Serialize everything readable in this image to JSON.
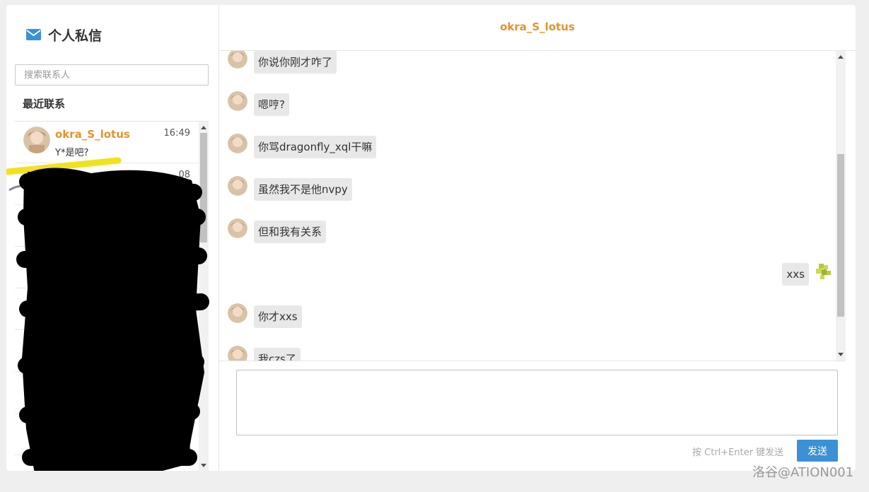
{
  "sidebar": {
    "title": "个人私信",
    "search_placeholder": "搜索联系人",
    "recent_label": "最近联系",
    "contacts": [
      {
        "name": "okra_S_lotus",
        "time": "16:49",
        "preview": "Y*是吧?"
      },
      {
        "name": "",
        "time": "08",
        "preview": ""
      }
    ]
  },
  "chat": {
    "title": "okra_S_lotus",
    "messages": [
      {
        "side": "left",
        "text": "你说你刚才咋了"
      },
      {
        "side": "left",
        "text": "嗯哼?"
      },
      {
        "side": "left",
        "text": "你骂dragonfly_xql干嘛"
      },
      {
        "side": "left",
        "text": "虽然我不是他nvpy"
      },
      {
        "side": "left",
        "text": "但和我有关系"
      },
      {
        "side": "right",
        "text": "xxs"
      },
      {
        "side": "left",
        "text": "你才xxs"
      },
      {
        "side": "left",
        "text": "我czs了"
      }
    ]
  },
  "composer": {
    "value": "",
    "hint": "按 Ctrl+Enter 键发送",
    "send_label": "发送"
  },
  "watermark": "洛谷@ATION001",
  "colors": {
    "accent": "#e5932a",
    "send": "#3a91d6"
  }
}
